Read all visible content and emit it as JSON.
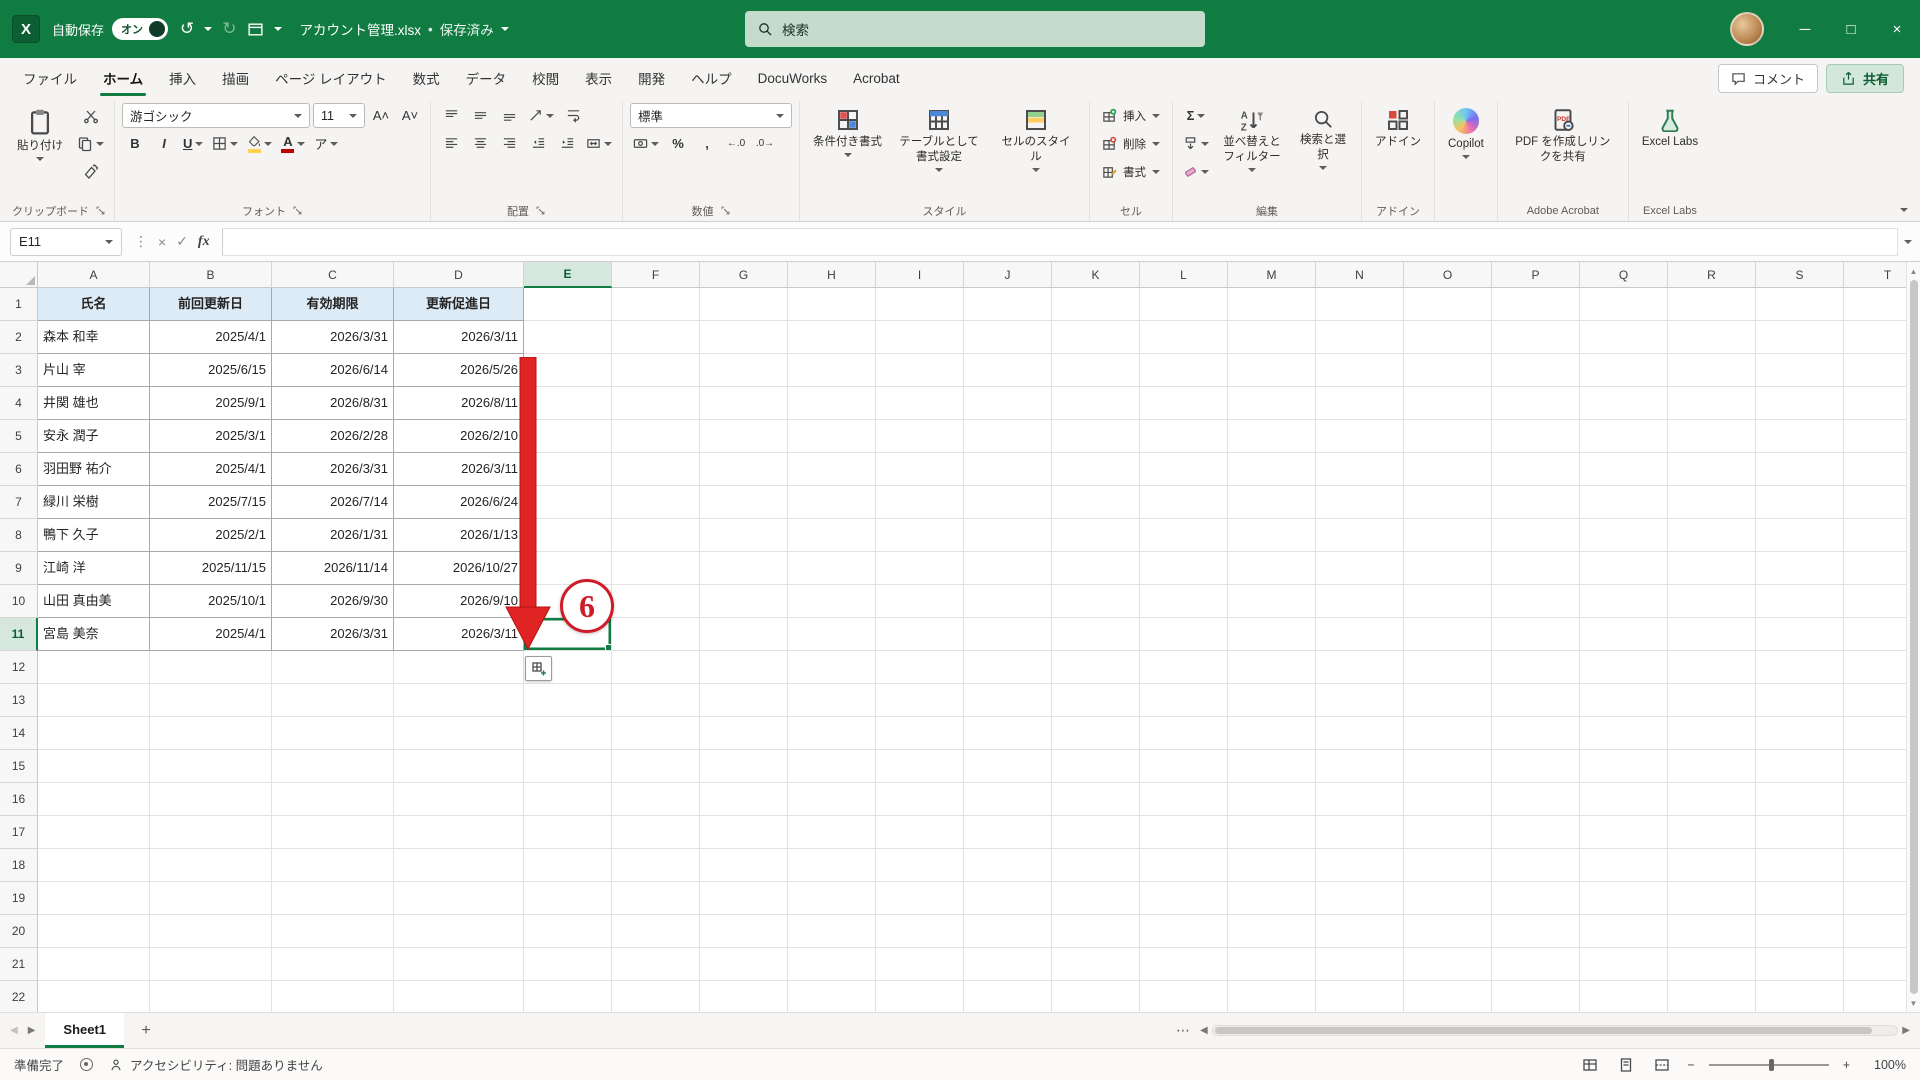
{
  "titlebar": {
    "app_name": "Excel",
    "autosave_label": "自動保存",
    "autosave_state": "オン",
    "doc_title": "アカウント管理.xlsx",
    "doc_status": "保存済み",
    "search_placeholder": "検索"
  },
  "menubar": {
    "tabs": [
      {
        "label": "ファイル",
        "active": false
      },
      {
        "label": "ホーム",
        "active": true
      },
      {
        "label": "挿入",
        "active": false
      },
      {
        "label": "描画",
        "active": false
      },
      {
        "label": "ページ レイアウト",
        "active": false
      },
      {
        "label": "数式",
        "active": false
      },
      {
        "label": "データ",
        "active": false
      },
      {
        "label": "校閲",
        "active": false
      },
      {
        "label": "表示",
        "active": false
      },
      {
        "label": "開発",
        "active": false
      },
      {
        "label": "ヘルプ",
        "active": false
      },
      {
        "label": "DocuWorks",
        "active": false
      },
      {
        "label": "Acrobat",
        "active": false
      }
    ],
    "comments_label": "コメント",
    "share_label": "共有"
  },
  "ribbon": {
    "clipboard": {
      "group_label": "クリップボード",
      "paste_label": "貼り付け"
    },
    "font": {
      "group_label": "フォント",
      "font_name": "游ゴシック",
      "font_size": "11"
    },
    "alignment": {
      "group_label": "配置"
    },
    "number": {
      "group_label": "数値",
      "format_name": "標準"
    },
    "styles": {
      "group_label": "スタイル",
      "buttons": [
        "条件付き書式",
        "テーブルとして書式設定",
        "セルのスタイル"
      ]
    },
    "cells": {
      "group_label": "セル",
      "buttons": [
        "挿入",
        "削除",
        "書式"
      ]
    },
    "editing": {
      "group_label": "編集",
      "buttons": [
        "並べ替えとフィルター",
        "検索と選択"
      ]
    },
    "addins": {
      "group_label": "アドイン",
      "button_label": "アドイン"
    },
    "copilot": {
      "button_label": "Copilot"
    },
    "adobe": {
      "group_label": "Adobe Acrobat",
      "button_label": "PDF を作成しリンクを共有"
    },
    "labs": {
      "group_label": "Excel Labs",
      "button_label": "Excel Labs"
    }
  },
  "formula_bar": {
    "name_box": "E11",
    "formula_value": ""
  },
  "grid": {
    "column_headers": [
      "A",
      "B",
      "C",
      "D",
      "E",
      "F",
      "G",
      "H",
      "I",
      "J",
      "K",
      "L",
      "M",
      "N",
      "O",
      "P",
      "Q",
      "R",
      "S",
      "T"
    ],
    "row_count": 22,
    "selected_cell": "E11",
    "selected_column": "E",
    "selected_row": 11,
    "table": {
      "headers": [
        "氏名",
        "前回更新日",
        "有効期限",
        "更新促進日"
      ],
      "rows": [
        [
          "森本 和幸",
          "2025/4/1",
          "2026/3/31",
          "2026/3/11"
        ],
        [
          "片山 宰",
          "2025/6/15",
          "2026/6/14",
          "2026/5/26"
        ],
        [
          "井関 雄也",
          "2025/9/1",
          "2026/8/31",
          "2026/8/11"
        ],
        [
          "安永 潤子",
          "2025/3/1",
          "2026/2/28",
          "2026/2/10"
        ],
        [
          "羽田野 祐介",
          "2025/4/1",
          "2026/3/31",
          "2026/3/11"
        ],
        [
          "緑川 栄樹",
          "2025/7/15",
          "2026/7/14",
          "2026/6/24"
        ],
        [
          "鴨下 久子",
          "2025/2/1",
          "2026/1/31",
          "2026/1/13"
        ],
        [
          "江崎 洋",
          "2025/11/15",
          "2026/11/14",
          "2026/10/27"
        ],
        [
          "山田 真由美",
          "2025/10/1",
          "2026/9/30",
          "2026/9/10"
        ],
        [
          "宮島 美奈",
          "2025/4/1",
          "2026/3/31",
          "2026/3/11"
        ]
      ]
    },
    "annotation_number": "6"
  },
  "sheet_bar": {
    "tabs": [
      {
        "label": "Sheet1",
        "active": true
      }
    ]
  },
  "status_bar": {
    "ready_label": "準備完了",
    "accessibility_label": "アクセシビリティ: 問題ありません",
    "zoom_level": "100%"
  },
  "icons": {
    "app_letter": "X",
    "bold": "B",
    "italic": "I",
    "underline": "U",
    "sigma": "Σ",
    "percent": "%",
    "comma": ",",
    "decimal_increase": "←.0",
    "decimal_decrease": ".0→",
    "font_color": "A",
    "fill_letter": "◆",
    "ruby": "ア",
    "font_grow": "A˄",
    "font_shrink": "A˅",
    "fx": "fx",
    "cancel": "×",
    "enter": "✓",
    "more": "⋮",
    "ellipsis": "⋯",
    "undo": "↺",
    "redo": "↻",
    "orientation": "ab",
    "minimize": "─",
    "maximize": "□",
    "close": "×",
    "nav_left": "◀",
    "nav_right": "▶",
    "scroll_up": "▲",
    "scroll_down": "▼",
    "zoom_out": "−",
    "zoom_in": "+",
    "add_sheet": "+",
    "dot": "•"
  }
}
